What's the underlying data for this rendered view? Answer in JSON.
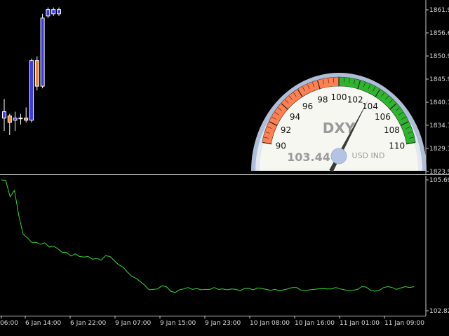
{
  "price_axis": {
    "labels": [
      "1861.95",
      "1856.65",
      "1850.95",
      "1845.95",
      "1840.15",
      "1834.75",
      "1829.35",
      "1823.95"
    ]
  },
  "indicator_axis": {
    "top_label": "105.69",
    "bottom_label": "102.82"
  },
  "time_axis": {
    "labels": [
      "06:00",
      "6 Jan 14:00",
      "6 Jan 22:00",
      "9 Jan 07:00",
      "9 Jan 15:00",
      "9 Jan 23:00",
      "10 Jan 08:00",
      "10 Jan 16:00",
      "11 Jan 01:00",
      "11 Jan 09:00"
    ]
  },
  "gauge": {
    "title": "DXY",
    "value": "103.44",
    "value_numeric": 103.44,
    "unit": "USD IND",
    "ticks": [
      "90",
      "92",
      "94",
      "96",
      "98",
      "100",
      "102",
      "104",
      "106",
      "108",
      "110"
    ],
    "min": 90,
    "max": 110,
    "red_to": 100,
    "colors": {
      "red": "#ff7f50",
      "green": "#2db52d",
      "bezel": "#aebdd8",
      "face": "#f7f7f2",
      "needle": "#3a3a3a",
      "hub": "#b3c3e3"
    }
  },
  "colors": {
    "background": "#000000",
    "bull_candle": "#3a3af0",
    "bear_candle": "#e88a3a",
    "indicator_line": "#33dd33",
    "axis_text": "#d9d9d9",
    "separator": "#c8c8c8"
  },
  "chart_data": [
    {
      "type": "candlestick",
      "ylim": [
        1823.95,
        1861.95
      ],
      "series": [
        {
          "open": 1836.5,
          "high": 1841.0,
          "low": 1833.5,
          "close": 1838.0
        },
        {
          "open": 1837.0,
          "high": 1837.5,
          "low": 1832.5,
          "close": 1835.5
        },
        {
          "open": 1836.0,
          "high": 1838.0,
          "low": 1833.5,
          "close": 1836.5
        },
        {
          "open": 1836.5,
          "high": 1837.5,
          "low": 1835.0,
          "close": 1836.5
        },
        {
          "open": 1836.5,
          "high": 1839.0,
          "low": 1835.5,
          "close": 1836.0
        },
        {
          "open": 1836.0,
          "high": 1850.5,
          "low": 1835.5,
          "close": 1850.0
        },
        {
          "open": 1850.0,
          "high": 1851.0,
          "low": 1843.0,
          "close": 1844.0
        },
        {
          "open": 1844.0,
          "high": 1861.0,
          "low": 1843.5,
          "close": 1860.0
        },
        {
          "open": 1860.5,
          "high": 1862.5,
          "low": 1860.0,
          "close": 1862.0
        },
        {
          "open": 1861.0,
          "high": 1862.5,
          "low": 1860.5,
          "close": 1862.0
        },
        {
          "open": 1861.0,
          "high": 1862.5,
          "low": 1860.5,
          "close": 1862.0
        }
      ]
    },
    {
      "type": "line",
      "ylim": [
        102.82,
        105.69
      ],
      "values": [
        105.69,
        105.68,
        105.32,
        105.46,
        104.91,
        104.5,
        104.42,
        104.32,
        104.32,
        104.28,
        104.31,
        104.22,
        104.24,
        104.18,
        104.1,
        104.1,
        104.02,
        104.07,
        104.01,
        104.0,
        104.01,
        103.95,
        103.97,
        103.93,
        104.03,
        104.01,
        103.92,
        103.83,
        103.78,
        103.67,
        103.58,
        103.53,
        103.46,
        103.38,
        103.28,
        103.29,
        103.3,
        103.37,
        103.35,
        103.25,
        103.22,
        103.28,
        103.3,
        103.33,
        103.29,
        103.31,
        103.28,
        103.29,
        103.29,
        103.33,
        103.29,
        103.3,
        103.28,
        103.3,
        103.29,
        103.26,
        103.31,
        103.31,
        103.28,
        103.32,
        103.31,
        103.29,
        103.27,
        103.29,
        103.26,
        103.28,
        103.3,
        103.33,
        103.33,
        103.27,
        103.26,
        103.28,
        103.29,
        103.3,
        103.31,
        103.3,
        103.3,
        103.33,
        103.3,
        103.28,
        103.26,
        103.27,
        103.29,
        103.35,
        103.34,
        103.27,
        103.25,
        103.27,
        103.33,
        103.35,
        103.33,
        103.29,
        103.32,
        103.35,
        103.33,
        103.35
      ]
    }
  ]
}
